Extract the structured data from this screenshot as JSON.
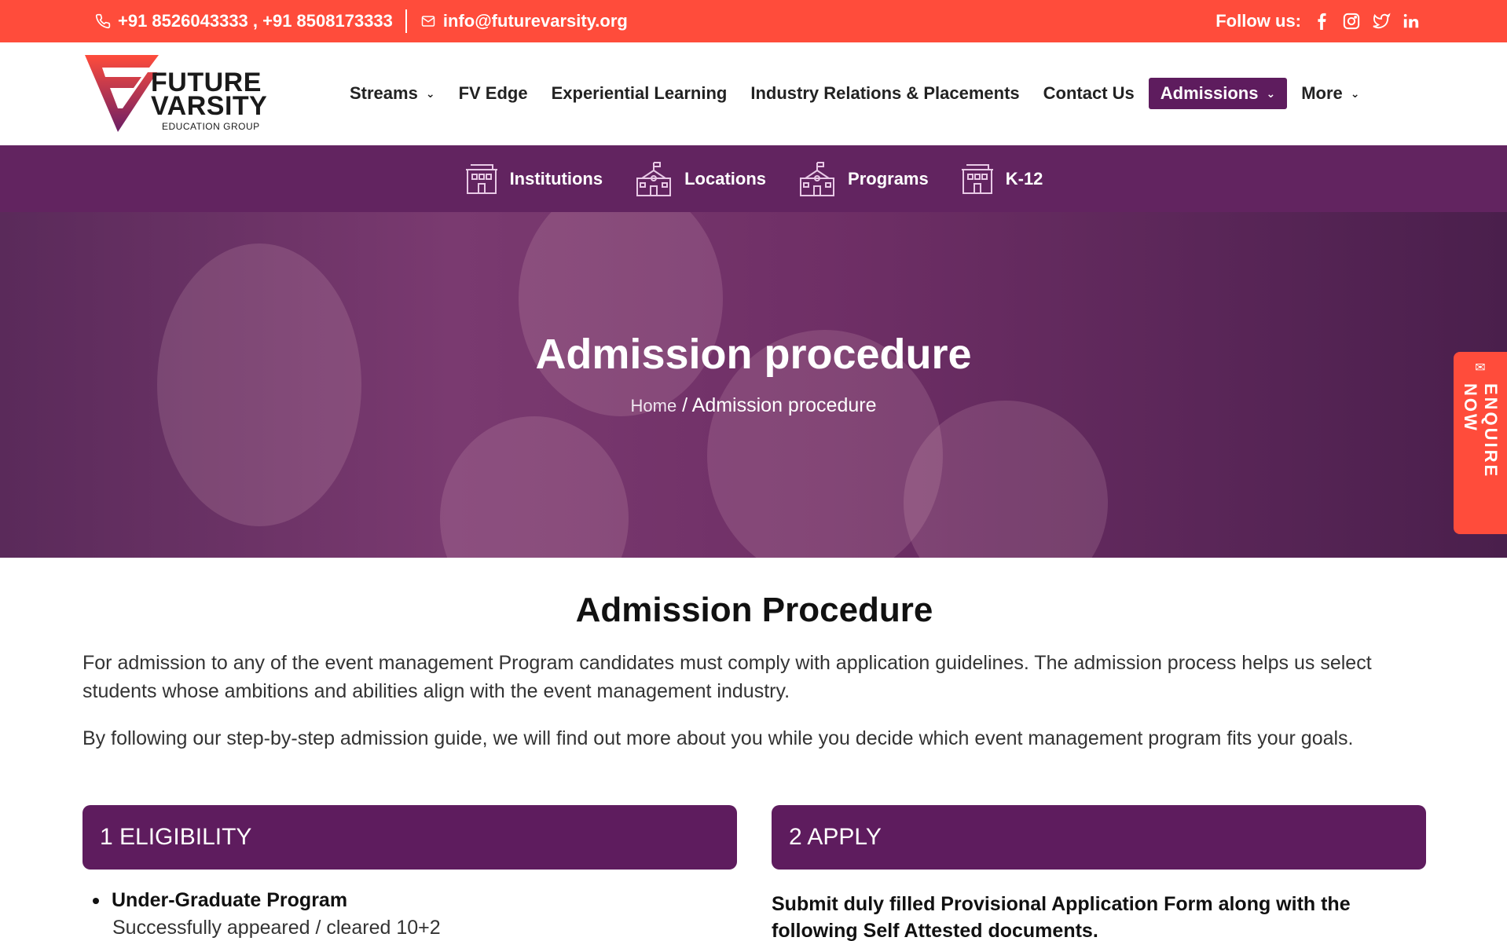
{
  "topbar": {
    "phones": "+91 8526043333 , +91 8508173333",
    "email": "info@futurevarsity.org",
    "follow_label": "Follow us:",
    "socials": [
      "facebook-icon",
      "instagram-icon",
      "twitter-icon",
      "linkedin-icon"
    ]
  },
  "logo": {
    "line1": "FUTURE",
    "line2": "VARSITY",
    "line3": "EDUCATION GROUP"
  },
  "nav": {
    "items": [
      {
        "label": "Streams",
        "dropdown": true
      },
      {
        "label": "FV Edge"
      },
      {
        "label": "Experiential Learning"
      },
      {
        "label": "Industry Relations & Placements"
      },
      {
        "label": "Contact Us"
      },
      {
        "label": "Admissions",
        "dropdown": true,
        "active": true
      },
      {
        "label": "More",
        "dropdown": true
      }
    ]
  },
  "subnav": {
    "items": [
      {
        "label": "Institutions",
        "icon": "building-icon"
      },
      {
        "label": "Locations",
        "icon": "school-icon"
      },
      {
        "label": "Programs",
        "icon": "school-icon"
      },
      {
        "label": "K-12",
        "icon": "building-icon"
      }
    ]
  },
  "hero": {
    "title": "Admission procedure",
    "breadcrumb_home": "Home",
    "breadcrumb_sep": " / ",
    "breadcrumb_current": "Admission procedure"
  },
  "enquire": {
    "label": "ENQUIRE NOW"
  },
  "content": {
    "title": "Admission Procedure",
    "para1": "For admission to any of the event management Program candidates must comply with application guidelines. The admission process helps us select students whose ambitions and abilities align with the event management industry.",
    "para2": "By following our step-by-step admission guide, we will find out more about you while you decide which event management program fits your goals."
  },
  "steps": {
    "step1": "1 ELIGIBILITY",
    "step2": "2 APPLY"
  },
  "eligibility": {
    "heading": "Under-Graduate Program",
    "detail": "Successfully appeared / cleared 10+2"
  },
  "apply": {
    "text": "Submit duly filled Provisional Application Form along with the following Self Attested documents."
  },
  "colors": {
    "accent": "#ff4c3b",
    "brand_purple": "#5e1c5e"
  }
}
